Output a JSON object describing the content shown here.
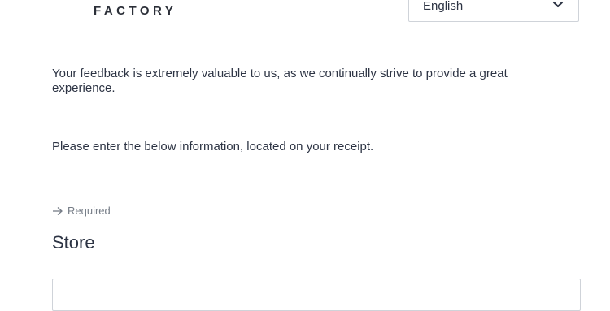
{
  "header": {
    "logo_text": "FACTORY",
    "language": {
      "selected": "English",
      "icon": "chevron-down-icon"
    }
  },
  "main": {
    "intro_text": "Your feedback is extremely valuable to us, as we continually strive to provide a great experience.",
    "instruction_text": "Please enter the below information, located on your receipt.",
    "required_label": "Required",
    "required_icon": "arrow-right-icon",
    "section_title": "Store",
    "store_input": {
      "value": "",
      "placeholder": ""
    }
  }
}
